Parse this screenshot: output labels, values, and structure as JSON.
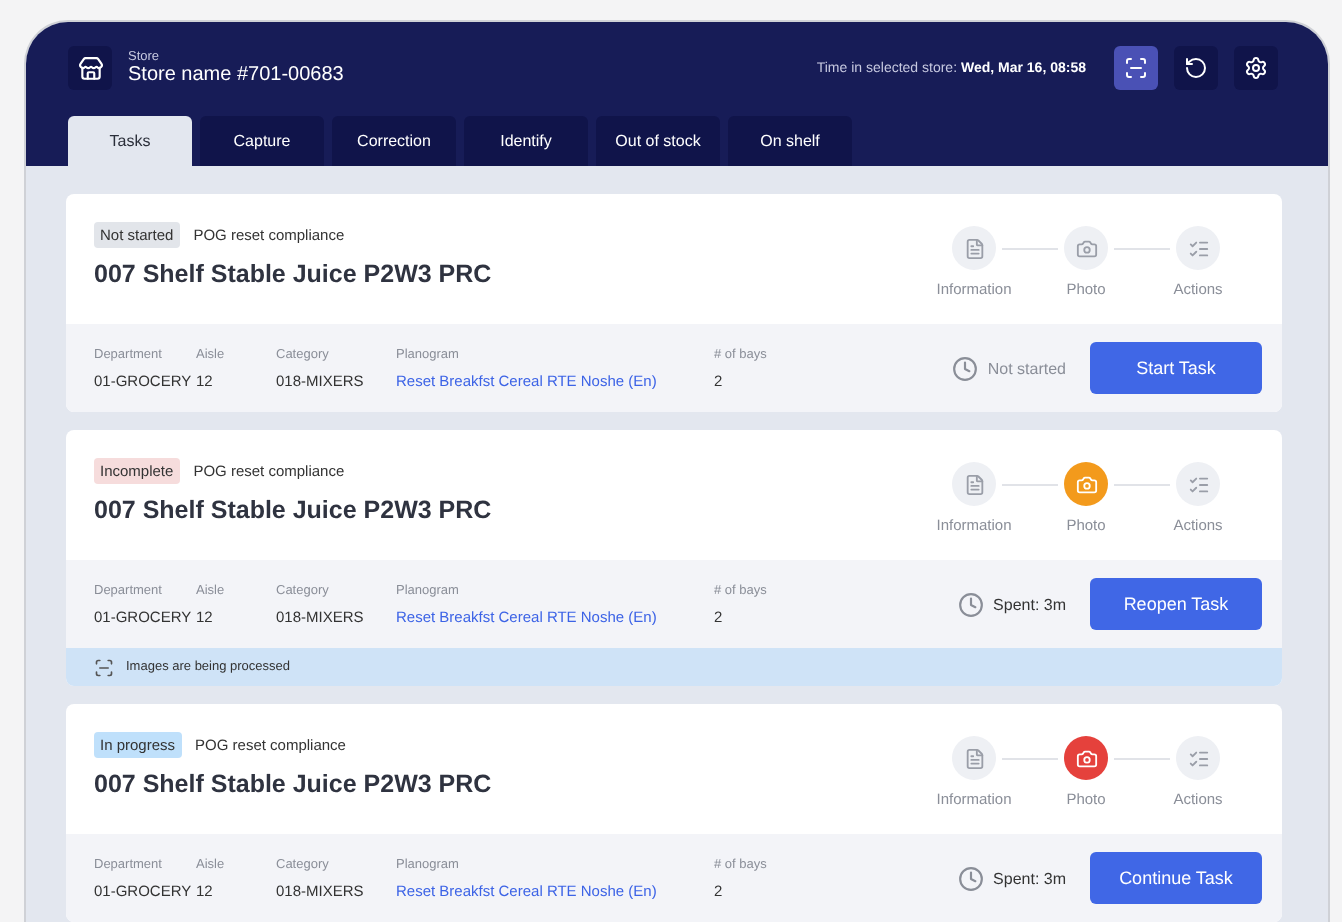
{
  "header": {
    "store_label": "Store",
    "store_name": "Store name #701-00683",
    "time_label": "Time in selected store:",
    "time_value": "Wed, Mar 16, 08:58",
    "actions": [
      {
        "kind": "scan",
        "selected": true
      },
      {
        "kind": "refresh",
        "selected": false
      },
      {
        "kind": "settings",
        "selected": false
      }
    ]
  },
  "tabs": [
    {
      "label": "Tasks",
      "selected": true
    },
    {
      "label": "Capture",
      "selected": false
    },
    {
      "label": "Correction",
      "selected": false
    },
    {
      "label": "Identify",
      "selected": false
    },
    {
      "label": "Out of stock",
      "selected": false
    },
    {
      "label": "On shelf",
      "selected": false
    }
  ],
  "tasks": [
    {
      "status": {
        "label": "Not started",
        "color": "#e2e5ea"
      },
      "type": "POG reset compliance",
      "title": "007 Shelf Stable Juice P2W3 PRC",
      "steps": [
        {
          "label": "Information",
          "color": "#eef0f4"
        },
        {
          "label": "Photo",
          "color": "#eef0f4"
        },
        {
          "label": "Actions",
          "color": "#eef0f4"
        }
      ],
      "fields": [
        {
          "label": "Department",
          "value": "01-GROCERY",
          "kind": "text"
        },
        {
          "label": "Aisle",
          "value": "12",
          "kind": "text"
        },
        {
          "label": "Category",
          "value": "018-MIXERS",
          "kind": "text"
        },
        {
          "label": "Planogram",
          "value": "Reset Breakfst Cereal RTE Noshe (En)",
          "kind": "link"
        },
        {
          "label": "# of bays",
          "value": "2",
          "kind": "text"
        }
      ],
      "time": "Not started",
      "time_muted": true,
      "button": "Start Task"
    },
    {
      "status": {
        "label": "Incomplete",
        "color": "#f6dcdc"
      },
      "type": "POG reset compliance",
      "title": "007 Shelf Stable Juice P2W3 PRC",
      "steps": [
        {
          "label": "Information",
          "color": "#eef0f4"
        },
        {
          "label": "Photo",
          "color": "#f39a1c"
        },
        {
          "label": "Actions",
          "color": "#eef0f4"
        }
      ],
      "fields": [
        {
          "label": "Department",
          "value": "01-GROCERY",
          "kind": "text"
        },
        {
          "label": "Aisle",
          "value": "12",
          "kind": "text"
        },
        {
          "label": "Category",
          "value": "018-MIXERS",
          "kind": "text"
        },
        {
          "label": "Planogram",
          "value": "Reset Breakfst Cereal RTE Noshe (En)",
          "kind": "link"
        },
        {
          "label": "# of bays",
          "value": "2",
          "kind": "text"
        }
      ],
      "time": "Spent: 3m",
      "time_muted": false,
      "button": "Reopen Task",
      "notice": "Images are being processed"
    },
    {
      "status": {
        "label": "In progress",
        "color": "#bfe0fb"
      },
      "type": "POG reset compliance",
      "title": "007 Shelf Stable Juice P2W3 PRC",
      "steps": [
        {
          "label": "Information",
          "color": "#eef0f4"
        },
        {
          "label": "Photo",
          "color": "#e5413c"
        },
        {
          "label": "Actions",
          "color": "#eef0f4"
        }
      ],
      "fields": [
        {
          "label": "Department",
          "value": "01-GROCERY",
          "kind": "text"
        },
        {
          "label": "Aisle",
          "value": "12",
          "kind": "text"
        },
        {
          "label": "Category",
          "value": "018-MIXERS",
          "kind": "text"
        },
        {
          "label": "Planogram",
          "value": "Reset Breakfst Cereal RTE Noshe (En)",
          "kind": "link"
        },
        {
          "label": "# of bays",
          "value": "2",
          "kind": "text"
        }
      ],
      "time": "Spent: 3m",
      "time_muted": false,
      "button": "Continue Task"
    }
  ]
}
